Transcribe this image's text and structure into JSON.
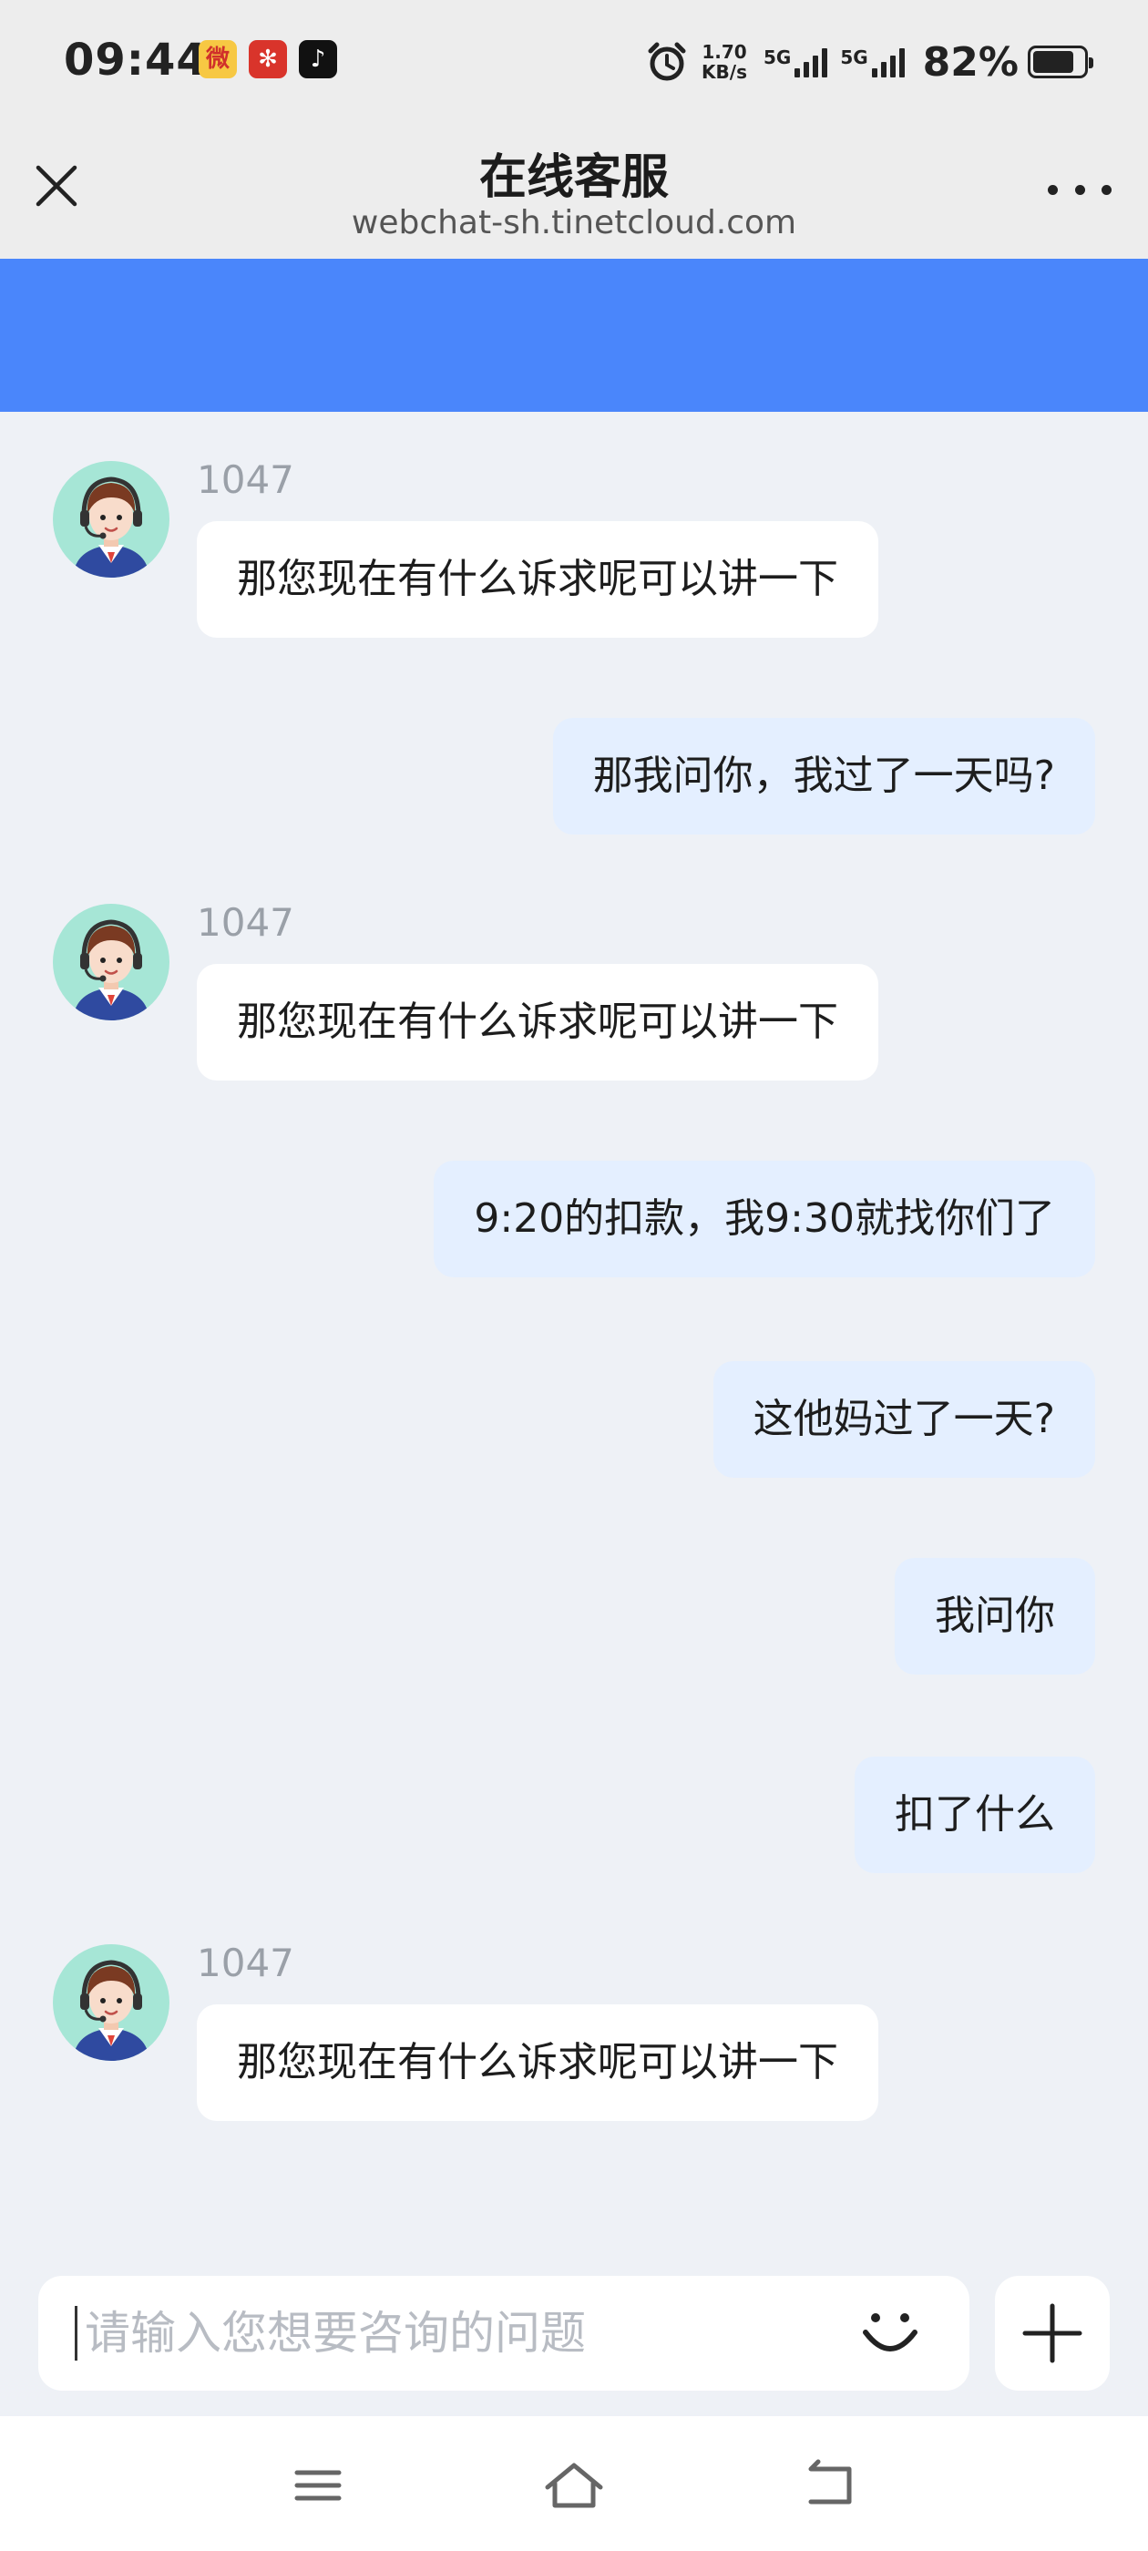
{
  "status_bar": {
    "time": "09:44",
    "apps": [
      {
        "icon": "weibo-icon",
        "glyph": "微"
      },
      {
        "icon": "news-app-icon",
        "glyph": "✻"
      },
      {
        "icon": "tiktok-icon",
        "glyph": "♪"
      }
    ],
    "net_speed_value": "1.70",
    "net_speed_unit": "KB/s",
    "network_1": "5G",
    "network_2": "5G",
    "battery": "82%",
    "battery_level": 0.82
  },
  "titlebar": {
    "title": "在线客服",
    "subtitle": "webchat-sh.tinetcloud.com",
    "close_icon": "close-icon",
    "more_icon": "more-dots-icon"
  },
  "accent_colors": {
    "header_band": "#4a86fb",
    "outgoing_bubble": "#e4efff",
    "incoming_bubble": "#ffffff",
    "chat_background": "#eef1f6"
  },
  "messages": [
    {
      "direction": "in",
      "sender": "1047",
      "text": "那您现在有什么诉求呢可以讲一下"
    },
    {
      "direction": "out",
      "text": "那我问你，我过了一天吗?"
    },
    {
      "direction": "in",
      "sender": "1047",
      "text": "那您现在有什么诉求呢可以讲一下"
    },
    {
      "direction": "out",
      "text": "9:20的扣款，我9:30就找你们了"
    },
    {
      "direction": "out",
      "text": "这他妈过了一天?"
    },
    {
      "direction": "out",
      "text": "我问你"
    },
    {
      "direction": "out",
      "text": "扣了什么"
    },
    {
      "direction": "in",
      "sender": "1047",
      "text": "那您现在有什么诉求呢可以讲一下"
    }
  ],
  "input": {
    "placeholder": "请输入您想要咨询的问题",
    "value": "",
    "emoji_icon": "smiley-icon",
    "plus_icon": "plus-icon"
  },
  "navbar": {
    "icons": [
      "menu-icon",
      "home-icon",
      "back-icon"
    ]
  }
}
